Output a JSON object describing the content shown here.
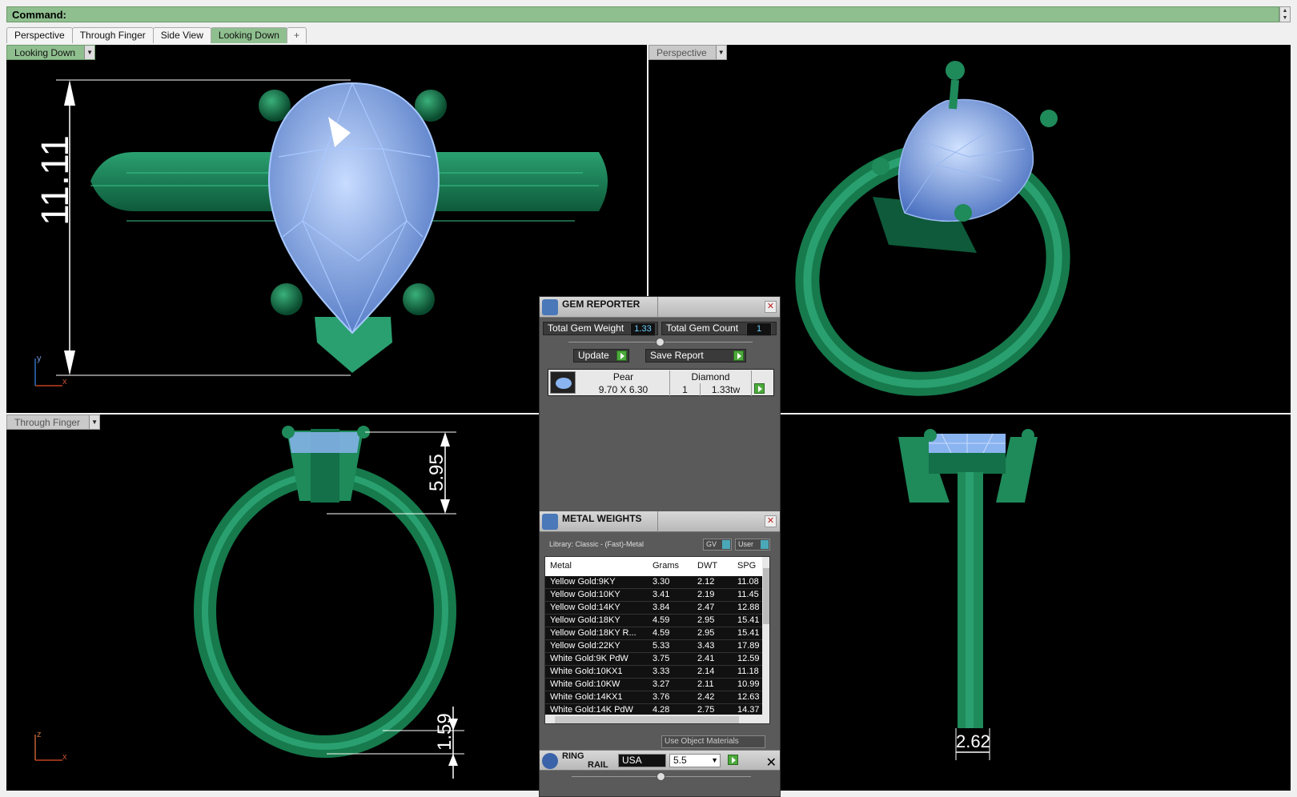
{
  "command": {
    "label": "Command:"
  },
  "tabs": [
    {
      "label": "Perspective"
    },
    {
      "label": "Through Finger"
    },
    {
      "label": "Side View"
    },
    {
      "label": "Looking Down"
    },
    {
      "label": "+"
    }
  ],
  "viewports": {
    "top_left": {
      "label": "Looking Down",
      "dimension": "11.11",
      "axis_v": "y",
      "axis_h": "x"
    },
    "top_right": {
      "label": "Perspective"
    },
    "bottom_left": {
      "label": "Through Finger",
      "dimension_top": "5.95",
      "dimension_bottom": "1.59",
      "axis_v": "z",
      "axis_h": "x"
    },
    "bottom_right": {
      "dimension": "2.62"
    }
  },
  "colors": {
    "ring": "#1f8a5a",
    "gem": "#8ab4f0",
    "accent": "#8fbf8f"
  },
  "gem_reporter": {
    "title": "GEM REPORTER",
    "total_weight_label": "Total Gem Weight",
    "total_weight": "1.33",
    "total_count_label": "Total Gem Count",
    "total_count": "1",
    "update_label": "Update",
    "save_label": "Save Report",
    "gem": {
      "shape": "Pear",
      "size": "9.70 X 6.30",
      "material": "Diamond",
      "count": "1",
      "weight": "1.33tw"
    }
  },
  "metal_weights": {
    "title": "METAL WEIGHTS",
    "library": "Library: Classic - (Fast)-Metal",
    "gv_label": "GV",
    "user_label": "User",
    "headers": [
      "Metal",
      "Grams",
      "DWT",
      "SPG"
    ],
    "rows": [
      [
        "Yellow Gold:9KY",
        "3.30",
        "2.12",
        "11.08"
      ],
      [
        "Yellow Gold:10KY",
        "3.41",
        "2.19",
        "11.45"
      ],
      [
        "Yellow Gold:14KY",
        "3.84",
        "2.47",
        "12.88"
      ],
      [
        "Yellow Gold:18KY",
        "4.59",
        "2.95",
        "15.41"
      ],
      [
        "Yellow Gold:18KY R...",
        "4.59",
        "2.95",
        "15.41"
      ],
      [
        "Yellow Gold:22KY",
        "5.33",
        "3.43",
        "17.89"
      ],
      [
        "White Gold:9K PdW",
        "3.75",
        "2.41",
        "12.59"
      ],
      [
        "White Gold:10KX1",
        "3.33",
        "2.14",
        "11.18"
      ],
      [
        "White Gold:10KW",
        "3.27",
        "2.11",
        "10.99"
      ],
      [
        "White Gold:14KX1",
        "3.76",
        "2.42",
        "12.63"
      ],
      [
        "White Gold:14K PdW",
        "4.28",
        "2.75",
        "14.37"
      ]
    ],
    "use_object_materials": "Use Object Materials"
  },
  "ring_rail": {
    "title_1": "RING",
    "title_2": "RAIL",
    "country": "USA",
    "size": "5.5"
  }
}
